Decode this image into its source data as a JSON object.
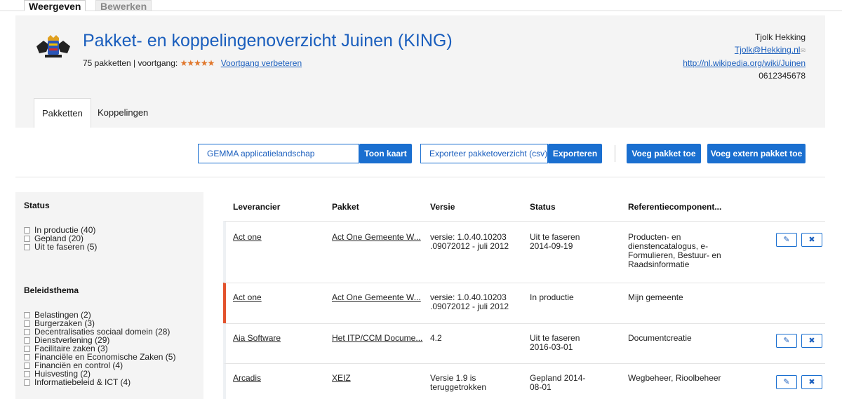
{
  "view_tabs": {
    "view": "Weergeven",
    "edit": "Bewerken"
  },
  "header": {
    "title": "Pakket- en koppelingenoverzicht Juinen (KING)",
    "package_count": "75 pakketten | voortgang:",
    "stars": "★★★★★",
    "improve_link": "Voortgang verbeteren",
    "contact": {
      "name": "Tjolk Hekking",
      "email": "Tjolk@Hekking.nl",
      "url": "http://nl.wikipedia.org/wiki/Juinen",
      "phone": "0612345678"
    },
    "tabs": [
      "Pakketten",
      "Koppelingen"
    ]
  },
  "toolbar": {
    "landscape_select": "GEMMA applicatielandschap",
    "show_map_button": "Toon kaart",
    "export_select": "Exporteer pakketoverzicht (csv)",
    "export_button": "Exporteren",
    "add_package_button": "Voeg pakket toe",
    "add_external_button": "Voeg extern pakket toe"
  },
  "sidebar": {
    "status": {
      "title": "Status",
      "items": [
        "In productie (40)",
        "Gepland (20)",
        "Uit te faseren (5)"
      ]
    },
    "theme": {
      "title": "Beleidsthema",
      "items": [
        "Belastingen (2)",
        "Burgerzaken (3)",
        "Decentralisaties sociaal domein (28)",
        "Dienstverlening (29)",
        "Facilitaire zaken (3)",
        "Financiële en Economische Zaken (5)",
        "Financiën en control (4)",
        "Huisvesting (2)",
        "Informatiebeleid & ICT (4)"
      ]
    }
  },
  "table": {
    "columns": [
      "Leverancier",
      "Pakket",
      "Versie",
      "Status",
      "Referentiecomponent..."
    ],
    "rows": [
      {
        "supplier": "Act one",
        "package": "Act One Gemeente W...",
        "version": "versie: 1.0.40.10203 .09072012 - juli 2012",
        "status": "Uit te faseren 2014-09-19",
        "component": "Producten- en dienstencatalogus, e-Formulieren, Bestuur- en Raadsinformatie",
        "has_actions": true
      },
      {
        "supplier": "Act one",
        "package": "Act One Gemeente W...",
        "version": "versie: 1.0.40.10203 .09072012 - juli 2012",
        "status": "In productie",
        "component": "Mijn gemeente",
        "has_actions": false
      },
      {
        "supplier": "Aia Software",
        "package": "Het ITP/CCM Docume...",
        "version": "4.2",
        "status": "Uit te faseren 2016-03-01",
        "component": "Documentcreatie",
        "has_actions": true
      },
      {
        "supplier": "Arcadis",
        "package": "XEIZ",
        "version": "Versie 1.9 is teruggetrokken",
        "status": "Gepland 2014-08-01",
        "component": "Wegbeheer, Rioolbeheer",
        "has_actions": true
      }
    ]
  },
  "icons": {
    "edit": "pencil-icon",
    "delete": "close-icon",
    "mail": "envelope-icon"
  }
}
